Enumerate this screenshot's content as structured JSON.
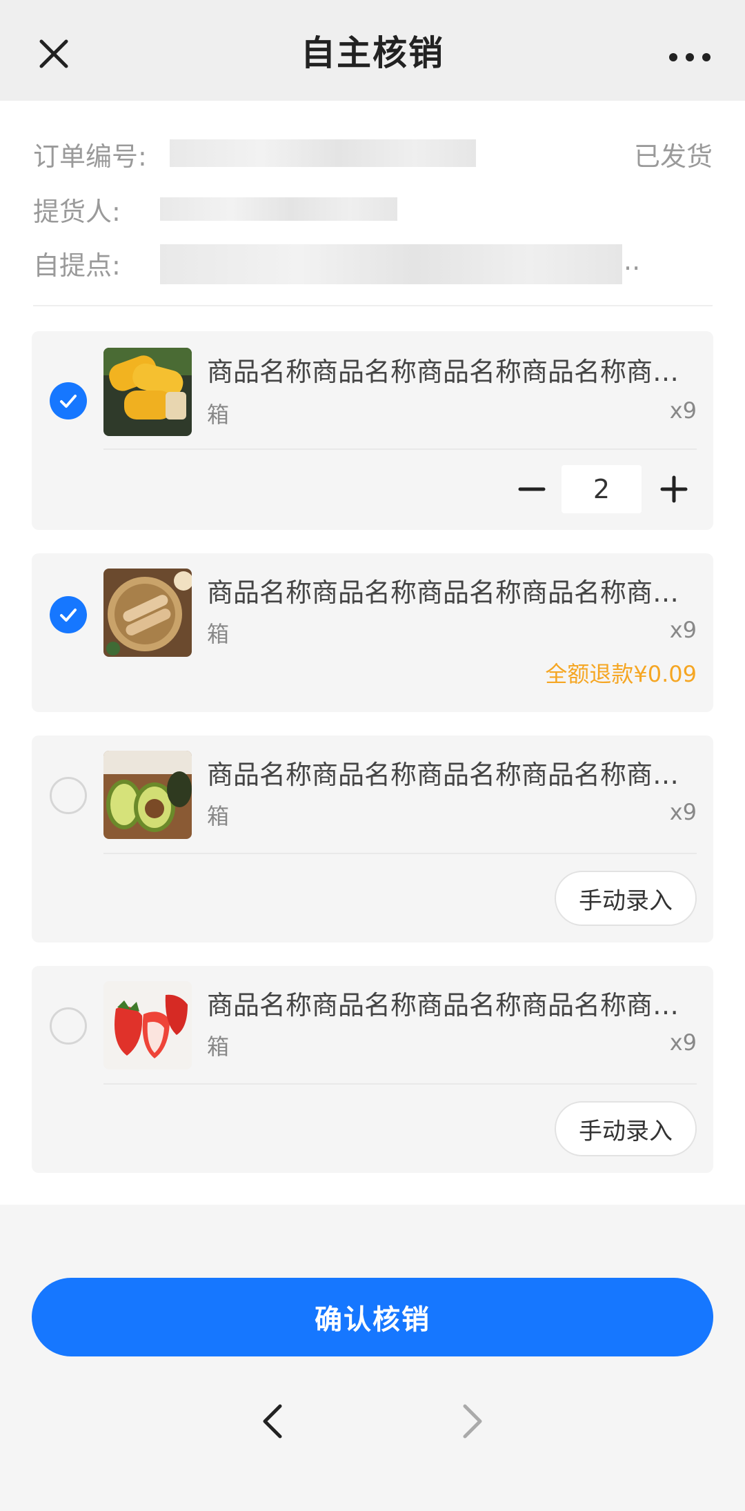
{
  "header": {
    "title": "自主核销",
    "close_icon": "close-icon",
    "more_icon": "more-icon"
  },
  "order": {
    "order_no_label": "订单编号:",
    "picker_label": "提货人:",
    "pickup_point_label": "自提点:",
    "pickup_point_ellipsis": "..",
    "status": "已发货"
  },
  "items": [
    {
      "name": "商品名称商品名称商品名称商品名称商品名称",
      "unit": "箱",
      "qty": "x9",
      "checked": true,
      "stepper_value": "2",
      "image_icon": "corn-image"
    },
    {
      "name": "商品名称商品名称商品名称商品名称商品名称",
      "unit": "箱",
      "qty": "x9",
      "checked": true,
      "refund_text": "全额退款¥0.09",
      "image_icon": "rolls-image"
    },
    {
      "name": "商品名称商品名称商品名称商品名称商品名称",
      "unit": "箱",
      "qty": "x9",
      "checked": false,
      "manual_label": "手动录入",
      "image_icon": "avocado-image"
    },
    {
      "name": "商品名称商品名称商品名称商品名称商品名称",
      "unit": "箱",
      "qty": "x9",
      "checked": false,
      "manual_label": "手动录入",
      "image_icon": "strawberry-image"
    }
  ],
  "footer": {
    "confirm_label": "确认核销"
  },
  "colors": {
    "accent": "#1677ff",
    "refund": "#f5a623",
    "card_bg": "#f5f5f5"
  }
}
